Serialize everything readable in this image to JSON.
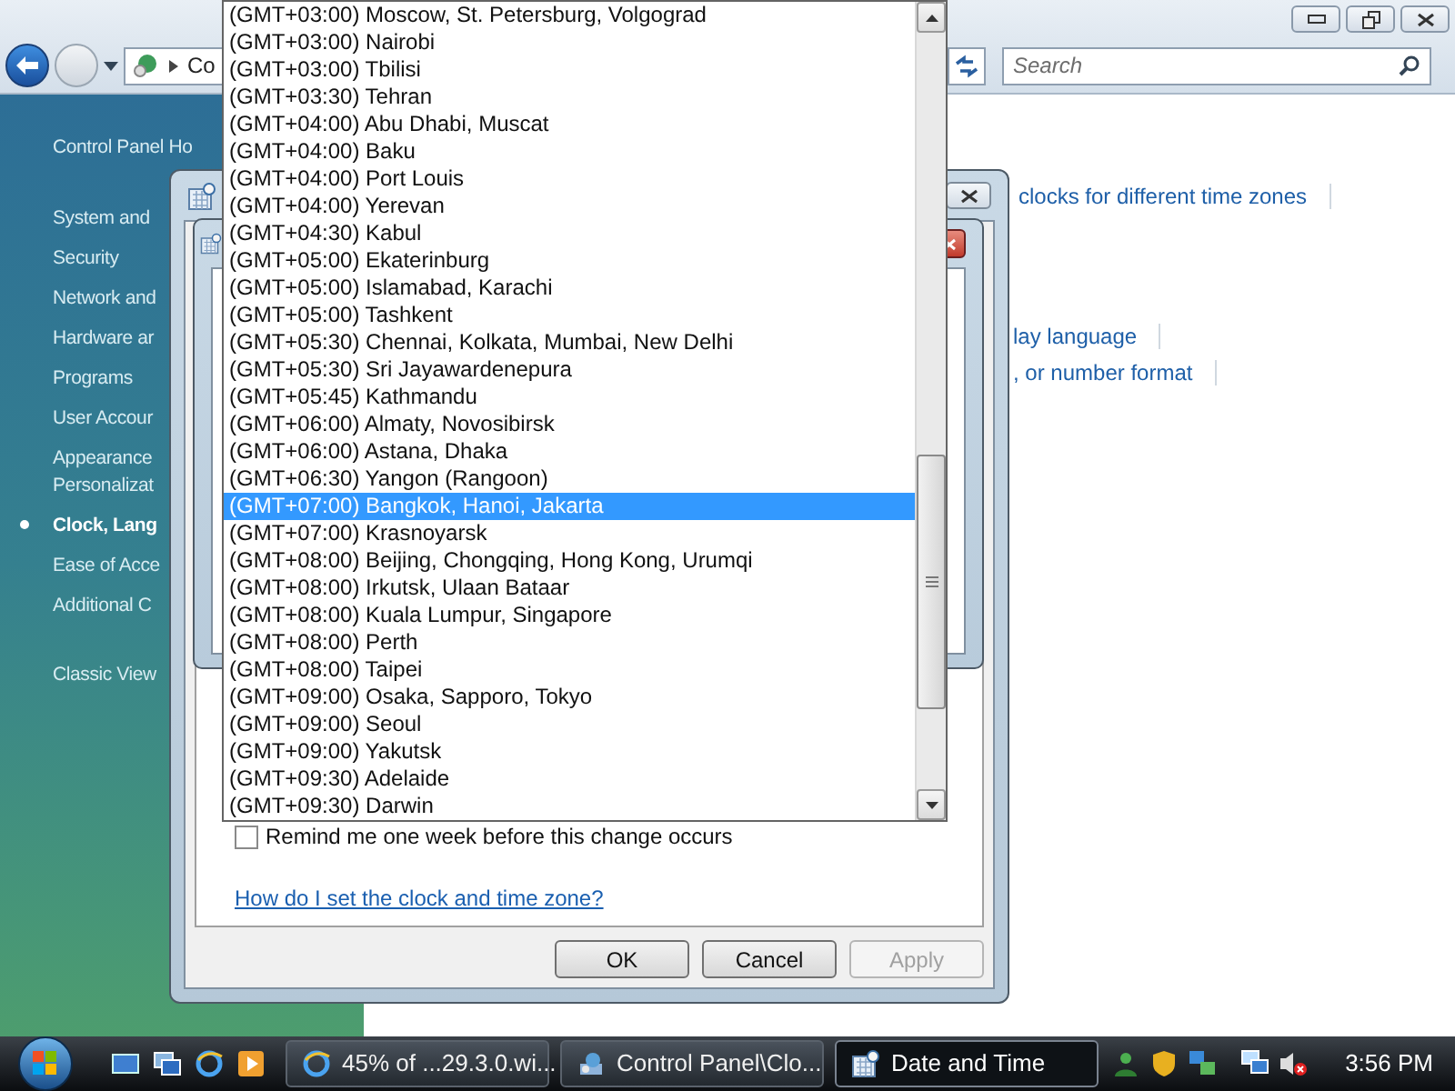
{
  "control_panel": {
    "address": "Co",
    "search": {
      "placeholder": "Search"
    },
    "sidebar": [
      {
        "label": "Control Panel Ho",
        "selected": false
      },
      {
        "label": "System and",
        "selected": false
      },
      {
        "label": "Security",
        "selected": false
      },
      {
        "label": "Network and",
        "selected": false
      },
      {
        "label": "Hardware ar",
        "selected": false
      },
      {
        "label": "Programs",
        "selected": false
      },
      {
        "label": "User Accour",
        "selected": false
      },
      {
        "label": "Appearance\nPersonalizat",
        "selected": false
      },
      {
        "label": "Clock, Lang",
        "selected": true
      },
      {
        "label": "Ease of Acce",
        "selected": false
      },
      {
        "label": "Additional C",
        "selected": false
      },
      {
        "label": "Classic View",
        "selected": false
      }
    ],
    "links": [
      "clocks for different time zones",
      "lay language",
      ", or number format"
    ]
  },
  "date_time_dialog": {
    "remind": {
      "label": "Remind me one week before this change occurs",
      "checked": false
    },
    "help_link": "How do I set the clock and time zone?",
    "buttons": [
      {
        "label": "OK",
        "disabled": false
      },
      {
        "label": "Cancel",
        "disabled": false
      },
      {
        "label": "Apply",
        "disabled": true
      }
    ]
  },
  "timezone_list": {
    "items": [
      {
        "label": "(GMT+03:00) Moscow, St. Petersburg, Volgograd",
        "selected": false
      },
      {
        "label": "(GMT+03:00) Nairobi",
        "selected": false
      },
      {
        "label": "(GMT+03:00) Tbilisi",
        "selected": false
      },
      {
        "label": "(GMT+03:30) Tehran",
        "selected": false
      },
      {
        "label": "(GMT+04:00) Abu Dhabi, Muscat",
        "selected": false
      },
      {
        "label": "(GMT+04:00) Baku",
        "selected": false
      },
      {
        "label": "(GMT+04:00) Port Louis",
        "selected": false
      },
      {
        "label": "(GMT+04:00) Yerevan",
        "selected": false
      },
      {
        "label": "(GMT+04:30) Kabul",
        "selected": false
      },
      {
        "label": "(GMT+05:00) Ekaterinburg",
        "selected": false
      },
      {
        "label": "(GMT+05:00) Islamabad, Karachi",
        "selected": false
      },
      {
        "label": "(GMT+05:00) Tashkent",
        "selected": false
      },
      {
        "label": "(GMT+05:30) Chennai, Kolkata, Mumbai, New Delhi",
        "selected": false
      },
      {
        "label": "(GMT+05:30) Sri Jayawardenepura",
        "selected": false
      },
      {
        "label": "(GMT+05:45) Kathmandu",
        "selected": false
      },
      {
        "label": "(GMT+06:00) Almaty, Novosibirsk",
        "selected": false
      },
      {
        "label": "(GMT+06:00) Astana, Dhaka",
        "selected": false
      },
      {
        "label": "(GMT+06:30) Yangon (Rangoon)",
        "selected": false
      },
      {
        "label": "(GMT+07:00) Bangkok, Hanoi, Jakarta",
        "selected": true
      },
      {
        "label": "(GMT+07:00) Krasnoyarsk",
        "selected": false
      },
      {
        "label": "(GMT+08:00) Beijing, Chongqing, Hong Kong, Urumqi",
        "selected": false
      },
      {
        "label": "(GMT+08:00) Irkutsk, Ulaan Bataar",
        "selected": false
      },
      {
        "label": "(GMT+08:00) Kuala Lumpur, Singapore",
        "selected": false
      },
      {
        "label": "(GMT+08:00) Perth",
        "selected": false
      },
      {
        "label": "(GMT+08:00) Taipei",
        "selected": false
      },
      {
        "label": "(GMT+09:00) Osaka, Sapporo, Tokyo",
        "selected": false
      },
      {
        "label": "(GMT+09:00) Seoul",
        "selected": false
      },
      {
        "label": "(GMT+09:00) Yakutsk",
        "selected": false
      },
      {
        "label": "(GMT+09:30) Adelaide",
        "selected": false
      },
      {
        "label": "(GMT+09:30) Darwin",
        "selected": false
      }
    ]
  },
  "taskbar": {
    "tasks": [
      {
        "label": "45% of ...29.3.0.wi...",
        "selected": false
      },
      {
        "label": "Control Panel\\Clo...",
        "selected": false
      },
      {
        "label": "Date and Time",
        "selected": true
      }
    ],
    "clock": "3:56 PM"
  }
}
